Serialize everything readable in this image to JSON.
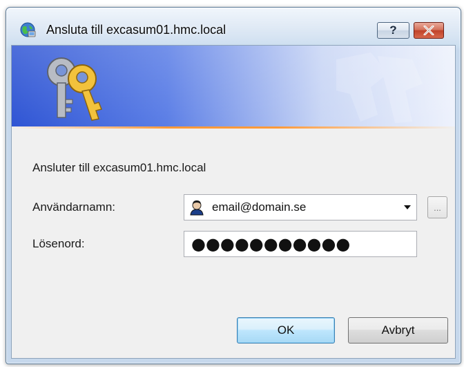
{
  "window": {
    "title": "Ansluta till excasum01.hmc.local",
    "help_label": "?"
  },
  "main": {
    "connecting_text": "Ansluter till excasum01.hmc.local",
    "username_label": "Användarnamn:",
    "username_value": "email@domain.se",
    "browse_label": "...",
    "password_label": "Lösenord:",
    "password_mask": "●●●●●●●●●●●"
  },
  "buttons": {
    "ok": "OK",
    "cancel": "Avbryt"
  },
  "colors": {
    "banner_blue": "#3a5fd6",
    "accent_orange": "#ff9a3a",
    "close_red": "#c0432a"
  }
}
